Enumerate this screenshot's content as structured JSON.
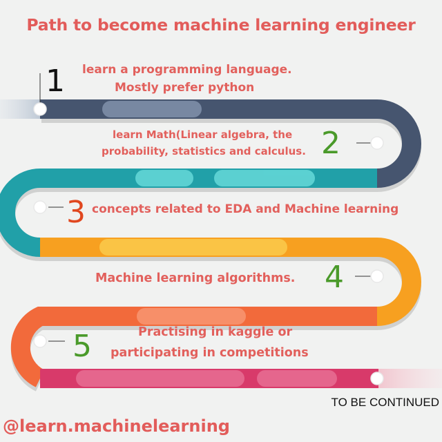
{
  "title": "Path to become machine learning engineer",
  "steps": [
    {
      "number": "1",
      "text_line1": "learn a programming language.",
      "text_line2": "Mostly prefer python",
      "color": "#46556f",
      "number_color": "#111111"
    },
    {
      "number": "2",
      "text_line1": "learn Math(Linear algebra, the",
      "text_line2": "probability, statistics and calculus.",
      "color": "#21a0a8",
      "number_color": "#4a9a2a"
    },
    {
      "number": "3",
      "text_line1": "concepts related to EDA and Machine learning",
      "color": "#f7a020",
      "number_color": "#e0471f"
    },
    {
      "number": "4",
      "text_line1": "Machine learning algorithms.",
      "color": "#f26a3b",
      "number_color": "#4a9a2a"
    },
    {
      "number": "5",
      "text_line1": "Practising in kaggle or",
      "text_line2": "participating in competitions",
      "color": "#d83a6a",
      "number_color": "#4a9a2a"
    }
  ],
  "footer": {
    "continued": "TO BE CONTINUED",
    "handle": "@learn.machinelearning"
  },
  "colors": {
    "background": "#f1f2f1",
    "text_accent": "#e25c5a"
  }
}
